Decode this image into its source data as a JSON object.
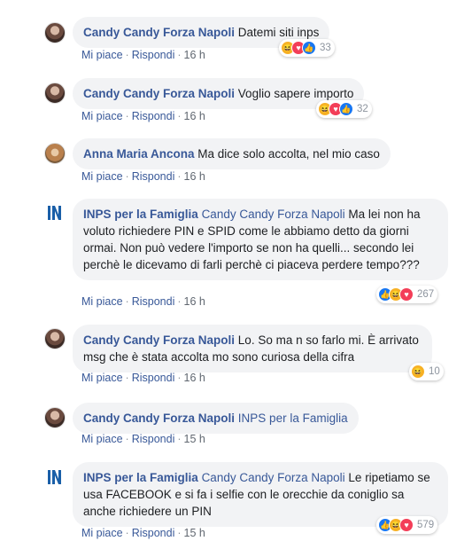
{
  "comments": [
    {
      "author": "Candy Candy Forza Napoli",
      "tag": "",
      "text": "Datemi siti inps",
      "like": "Mi piace",
      "reply": "Rispondi",
      "time": "16 h",
      "reactions": [
        "haha-icon",
        "love-icon",
        "like-icon"
      ],
      "count": "33"
    },
    {
      "author": "Candy Candy Forza Napoli",
      "tag": "",
      "text": "Voglio sapere importo",
      "like": "Mi piace",
      "reply": "Rispondi",
      "time": "16 h",
      "reactions": [
        "haha-icon",
        "love-icon",
        "like-icon"
      ],
      "count": "32"
    },
    {
      "author": "Anna Maria Ancona",
      "tag": "",
      "text": "Ma dice solo accolta, nel mio caso",
      "like": "Mi piace",
      "reply": "Rispondi",
      "time": "16 h"
    },
    {
      "author": "INPS per la Famiglia",
      "tag": "Candy Candy Forza Napoli",
      "text": "Ma lei non ha voluto richiedere PIN e SPID come le abbiamo detto da giorni ormai. Non può vedere l'importo se non ha quelli... secondo lei perchè le dicevamo di farli perchè ci piaceva perdere tempo???",
      "like": "Mi piace",
      "reply": "Rispondi",
      "time": "16 h",
      "reactions": [
        "like-icon",
        "haha-icon",
        "love-icon"
      ],
      "count": "267"
    },
    {
      "author": "Candy Candy Forza Napoli",
      "tag": "",
      "text": "Lo. So ma n so farlo mi. È arrivato msg che è stata accolta mo sono curiosa della cifra",
      "like": "Mi piace",
      "reply": "Rispondi",
      "time": "16 h",
      "reactions": [
        "haha-icon"
      ],
      "count": "10"
    },
    {
      "author": "Candy Candy Forza Napoli",
      "tag": "INPS per la Famiglia",
      "text": "",
      "like": "Mi piace",
      "reply": "Rispondi",
      "time": "15 h"
    },
    {
      "author": "INPS per la Famiglia",
      "tag": "Candy Candy Forza Napoli",
      "text": "Le ripetiamo se usa FACEBOOK e si fa i selfie con le orecchie da coniglio sa anche richiedere un PIN",
      "like": "Mi piace",
      "reply": "Rispondi",
      "time": "15 h",
      "reactions": [
        "like-icon",
        "haha-icon",
        "love-icon"
      ],
      "count": "579"
    }
  ],
  "colors": {
    "link": "#385898",
    "bubble": "#f2f3f5",
    "meta": "#606770",
    "like": "#1877f2",
    "love": "#f33e58",
    "haha": "#f7b125"
  }
}
